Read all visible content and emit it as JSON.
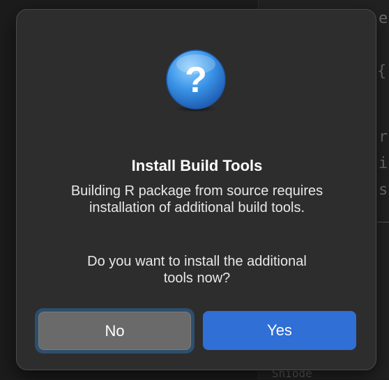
{
  "background": {
    "editor_chars": [
      "e",
      "{",
      "r",
      "i",
      "s"
    ],
    "bottom_text": "Shiode"
  },
  "dialog": {
    "icon": "question-mark-icon",
    "title": "Install Build Tools",
    "message_line1": "Building R package from source requires",
    "message_line2": "installation of additional build tools.",
    "question_line1": "Do you want to install the additional",
    "question_line2": "tools now?",
    "buttons": {
      "no_label": "No",
      "yes_label": "Yes"
    },
    "colors": {
      "dialog_bg": "#2d2d2d",
      "primary_button": "#2f6fd6",
      "secondary_button": "#6a6a6a",
      "focus_ring": "#2e4f6d"
    }
  }
}
